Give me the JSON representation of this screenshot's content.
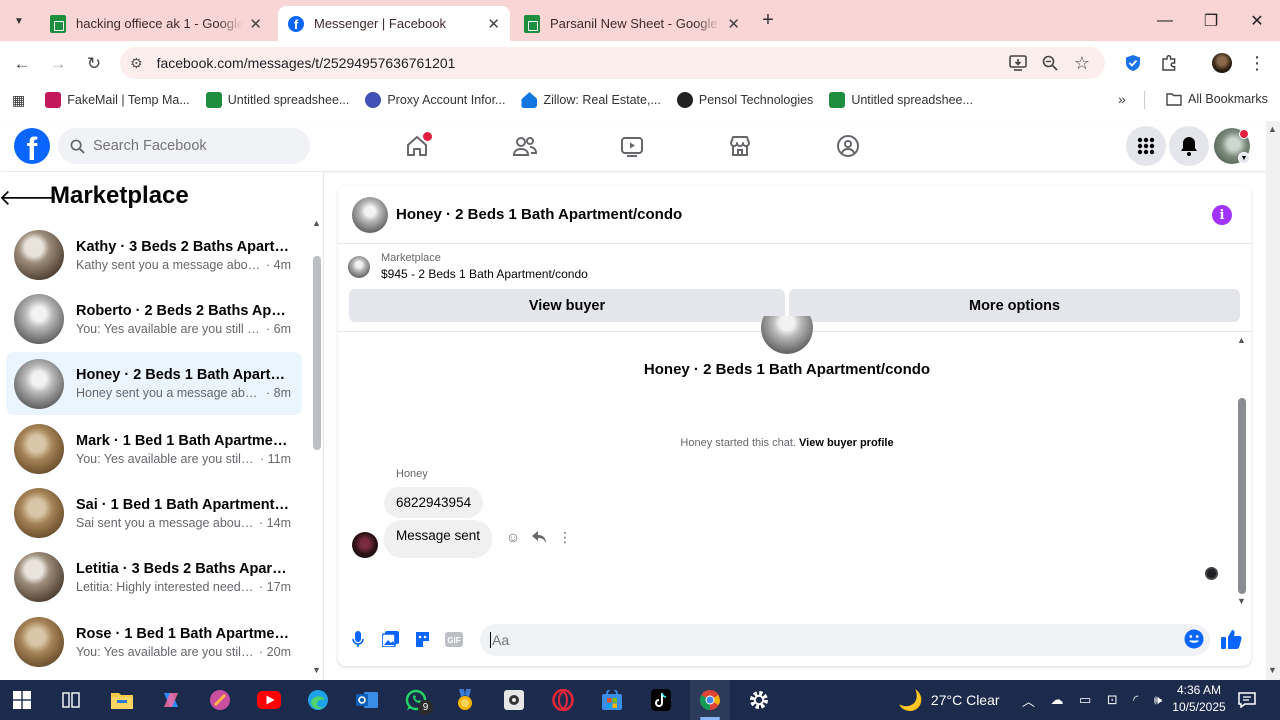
{
  "browser": {
    "tabs": [
      {
        "label": "hacking offiece ak 1 - Google Sheets",
        "icon": "sheets-icon",
        "active": false
      },
      {
        "label": "Messenger | Facebook",
        "icon": "facebook-icon",
        "active": true
      },
      {
        "label": "Parsanil New Sheet - Google Sheets",
        "icon": "sheets-icon",
        "active": false
      }
    ],
    "url": "facebook.com/messages/t/25294957636761201",
    "bookmarks": [
      {
        "label": "FakeMail | Temp Ma...",
        "color": "#c2185b"
      },
      {
        "label": "Untitled spreadshee...",
        "color": "#1e8e3e"
      },
      {
        "label": "Proxy Account Infor...",
        "color": "#3f51b5"
      },
      {
        "label": "Zillow: Real Estate,...",
        "color": "#1277e1"
      },
      {
        "label": "Pensol Technologies",
        "color": "#222222"
      },
      {
        "label": "Untitled spreadshee...",
        "color": "#1e8e3e"
      }
    ],
    "all_bookmarks": "All Bookmarks"
  },
  "facebook": {
    "search_placeholder": "Search Facebook",
    "accent": "#0866ff"
  },
  "sidebar": {
    "title": "Marketplace",
    "conversations": [
      {
        "name": "Kathy · 3 Beds 2 Baths Apartment/condo",
        "preview": "Kathy sent you a message about y...",
        "time": "· 4m",
        "avatar": "a"
      },
      {
        "name": "Roberto · 2 Beds 2 Baths Apartment/condo",
        "preview": "You: Yes available are you still inter...",
        "time": "· 6m",
        "avatar": "b"
      },
      {
        "name": "Honey · 2 Beds 1 Bath Apartment/condo",
        "preview": "Honey sent you a message about ...",
        "time": "· 8m",
        "avatar": "b",
        "selected": true
      },
      {
        "name": "Mark · 1 Bed 1 Bath Apartment/condo",
        "preview": "You: Yes available are you still int...",
        "time": "· 11m",
        "avatar": "c"
      },
      {
        "name": "Sai · 1 Bed 1 Bath Apartment/condo",
        "preview": "Sai sent you a message about yo...",
        "time": "· 14m",
        "avatar": "c"
      },
      {
        "name": "Letitia · 3 Beds 2 Baths Apartment/condo",
        "preview": "Letitia: Highly interested need to ...",
        "time": "· 17m",
        "avatar": "a"
      },
      {
        "name": "Rose · 1 Bed 1 Bath Apartment/condo",
        "preview": "You: Yes available are you still int...",
        "time": "· 20m",
        "avatar": "c"
      }
    ]
  },
  "chat": {
    "title": "Honey · 2 Beds 1 Bath Apartment/condo",
    "listing_source": "Marketplace",
    "listing": "$945 - 2 Beds 1 Bath Apartment/condo",
    "view_buyer": "View buyer",
    "more_options": "More options",
    "center_name": "Honey · 2 Beds 1 Bath Apartment/condo",
    "started_text": "Honey started this chat.",
    "view_buyer_profile": "View buyer profile",
    "sender_name": "Honey",
    "messages": [
      "6822943954",
      "Message sent"
    ],
    "input_placeholder": "Aa"
  },
  "taskbar": {
    "weather": "27°C  Clear",
    "time": "4:36 AM",
    "date": "10/5/2025",
    "whatsapp_badge": "9"
  }
}
